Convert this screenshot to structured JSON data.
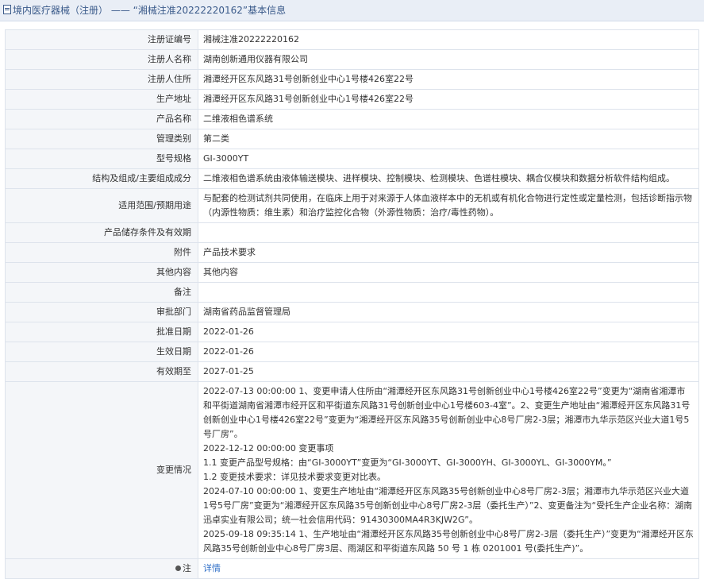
{
  "header": {
    "title": "境内医疗器械（注册）",
    "dash": "——",
    "subtitle": "“湘械注准20222220162”基本信息",
    "doc_icon": "document-icon"
  },
  "rows": [
    {
      "label": "注册证编号",
      "value": "湘械注准20222220162"
    },
    {
      "label": "注册人名称",
      "value": "湖南创新通用仪器有限公司"
    },
    {
      "label": "注册人住所",
      "value": "湘潭经开区东风路31号创新创业中心1号楼426室22号"
    },
    {
      "label": "生产地址",
      "value": "湘潭经开区东风路31号创新创业中心1号楼426室22号"
    },
    {
      "label": "产品名称",
      "value": "二维液相色谱系统"
    },
    {
      "label": "管理类别",
      "value": "第二类"
    },
    {
      "label": "型号规格",
      "value": "GI-3000YT"
    },
    {
      "label": "结构及组成/主要组成成分",
      "value": "二维液相色谱系统由液体输送模块、进样模块、控制模块、检测模块、色谱柱模块、耦合仪模块和数据分析软件结构组成。"
    },
    {
      "label": "适用范围/预期用途",
      "value": "与配套的检测试剂共同使用，在临床上用于对来源于人体血液样本中的无机或有机化合物进行定性或定量检测，包括诊断指示物（内源性物质：维生素）和治疗监控化合物（外源性物质：治疗/毒性药物）。"
    },
    {
      "label": "产品储存条件及有效期",
      "value": ""
    },
    {
      "label": "附件",
      "value": "产品技术要求"
    },
    {
      "label": "其他内容",
      "value": "其他内容"
    },
    {
      "label": "备注",
      "value": ""
    },
    {
      "label": "审批部门",
      "value": "湖南省药品监督管理局"
    },
    {
      "label": "批准日期",
      "value": "2022-01-26"
    },
    {
      "label": "生效日期",
      "value": "2022-01-26"
    },
    {
      "label": "有效期至",
      "value": "2027-01-25"
    }
  ],
  "changes": {
    "label": "变更情况",
    "lines": [
      "2022-07-13 00:00:00 1、变更申请人住所由“湘潭经开区东风路31号创新创业中心1号楼426室22号”变更为“湖南省湘潭市和平街道湖南省湘潭市经开区和平街道东风路31号创新创业中心1号楼603-4室”。2、变更生产地址由“湘潭经开区东风路31号创新创业中心1号楼426室22号”变更为“湘潭经开区东风路35号创新创业中心8号厂房2-3层；湘潭市九华示范区兴业大道1号5号厂房”。",
      "2022-12-12 00:00:00 变更事项",
      "1.1 变更产品型号规格：由“GI-3000YT”变更为“GI-3000YT、GI-3000YH、GI-3000YL、GI-3000YM。”",
      "1.2 变更技术要求：详见技术要求变更对比表。",
      "2024-07-10 00:00:00 1、变更生产地址由“湘潭经开区东风路35号创新创业中心8号厂房2-3层；湘潭市九华示范区兴业大道1号5号厂房”变更为“湘潭经开区东风路35号创新创业中心8号厂房2-3层（委托生产）”2、变更备注为“受托生产企业名称：湖南迅卓实业有限公司；统一社会信用代码：91430300MA4R3KJW2G”。",
      "2025-09-18 09:35:14 1、生产地址由“湘潭经开区东风路35号创新创业中心8号厂房2-3层（委托生产）”变更为“湘潭经开区东风路35号创新创业中心8号厂房3层、雨湖区和平街道东风路 50 号 1 栋 0201001 号(委托生产)”。"
    ]
  },
  "note": {
    "label": "注",
    "icon": "info-icon",
    "link_text": "详情"
  }
}
